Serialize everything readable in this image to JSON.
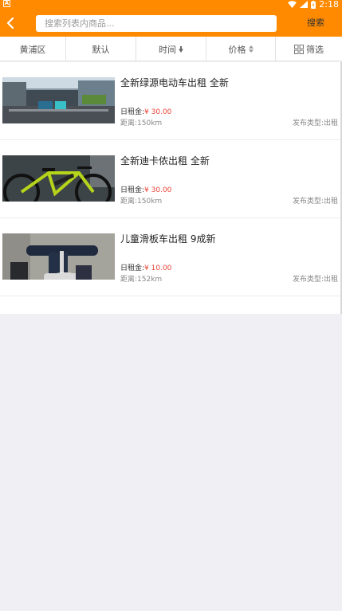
{
  "status_bar": {
    "time": "2:18",
    "left_icon": "A"
  },
  "header": {
    "search_placeholder": "搜索列表内商品...",
    "search_button": "搜索"
  },
  "filters": [
    {
      "label": "黄浦区",
      "icon": ""
    },
    {
      "label": "默认",
      "icon": ""
    },
    {
      "label": "时间",
      "icon": "sort-down-icon"
    },
    {
      "label": "价格",
      "icon": "sort-updown-icon"
    },
    {
      "label": "筛选",
      "icon": "grid-icon"
    }
  ],
  "items": [
    {
      "title": "全新绿源电动车出租 全新",
      "rent_label": "日租金:",
      "price": "¥ 30.00",
      "distance": "距离:150km",
      "type": "发布类型:出租",
      "thumb": "scooter-street-photo"
    },
    {
      "title": "全新迪卡侬出租 全新",
      "rent_label": "日租金:",
      "price": "¥ 30.00",
      "distance": "距离:150km",
      "type": "发布类型:出租",
      "thumb": "mountain-bike-photo"
    },
    {
      "title": "儿童滑板车出租 9成新",
      "rent_label": "日租金:",
      "price": "¥ 10.00",
      "distance": "距离:152km",
      "type": "发布类型:出租",
      "thumb": "kids-scooter-photo"
    }
  ],
  "colors": {
    "accent": "#ff8a00",
    "price": "#e94235"
  }
}
